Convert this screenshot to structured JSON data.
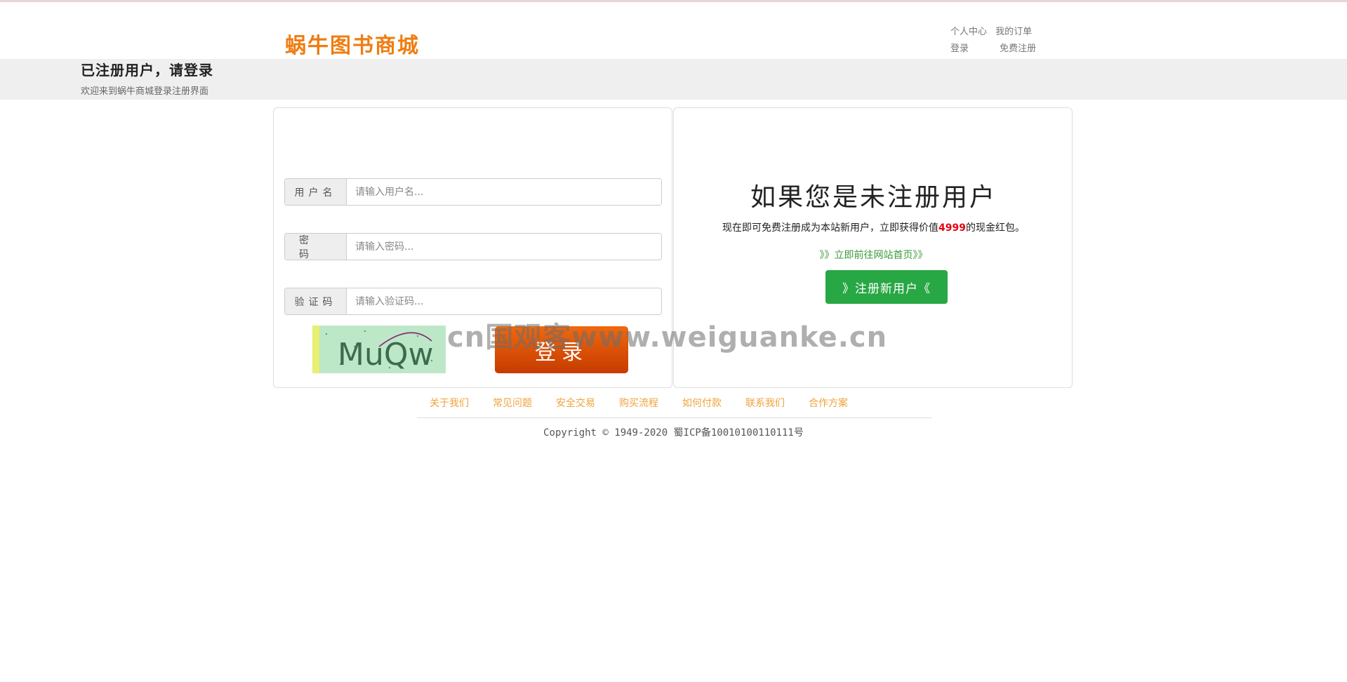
{
  "header": {
    "logo": "蜗牛图书商城",
    "links": {
      "personal_center": "个人中心",
      "my_orders": "我的订单",
      "login": "登录",
      "free_register": "免费注册"
    }
  },
  "banner": {
    "title": "已注册用户，请登录",
    "subtitle": "欢迎来到蜗牛商城登录注册界面"
  },
  "login_form": {
    "username": {
      "label": "用户名",
      "placeholder": "请输入用户名...",
      "value": ""
    },
    "password": {
      "label": "密码",
      "placeholder": "请输入密码...",
      "value": ""
    },
    "captcha": {
      "label": "验证码",
      "placeholder": "请输入验证码...",
      "value": ""
    },
    "captcha_image_text": "MuQw",
    "login_button": "登录"
  },
  "register_promo": {
    "title": "如果您是未注册用户",
    "text_before": "现在即可免费注册成为本站新用户，立即获得价值",
    "amount": "4999",
    "text_after": "的现金红包。",
    "home_link": "》》立即前往网站首页》》",
    "register_button": "》注册新用户《"
  },
  "watermark": "cn国观客www.weiguanke.cn",
  "footer": {
    "links": [
      "关于我们",
      "常见问题",
      "安全交易",
      "购买流程",
      "如何付款",
      "联系我们",
      "合作方案"
    ],
    "copyright": "Copyright © 1949-2020 蜀ICP备10010100110111号"
  },
  "colors": {
    "logo": "#ef7d12",
    "login_button": "#e0520a",
    "register_button": "#28a745",
    "footer_link": "#f0a23c",
    "amount": "#e60012"
  }
}
